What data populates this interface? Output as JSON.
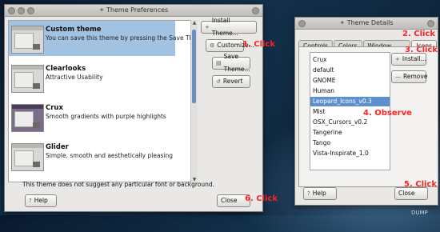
{
  "prefs_window": {
    "title": "Theme Preferences",
    "themes": [
      {
        "name": "Custom theme",
        "desc": "You can save this theme by pressing the Save Th...",
        "selected": true
      },
      {
        "name": "Clearlooks",
        "desc": "Attractive Usability",
        "selected": false
      },
      {
        "name": "Crux",
        "desc": "Smooth gradients with purple highlights",
        "selected": false
      },
      {
        "name": "Glider",
        "desc": "Simple, smooth and aesthetically pleasing",
        "selected": false
      }
    ],
    "buttons": {
      "install": "Install Theme...",
      "customize": "Customize...",
      "save": "Save Theme...",
      "revert": "Revert",
      "help": "Help",
      "close": "Close"
    },
    "note": "This theme does not suggest any particular font or background."
  },
  "details_window": {
    "title": "Theme Details",
    "tabs": [
      "Controls",
      "Colors",
      "Window Border",
      "Icons"
    ],
    "active_tab": "Icons",
    "icons": [
      "Crux",
      "default",
      "GNOME",
      "Human",
      "Leopard_Icons_v0.3",
      "Mist",
      "OSX_Cursors_v0.2",
      "Tangerine",
      "Tango",
      "Vista-Inspirate_1.0"
    ],
    "selected_icon": "Leopard_Icons_v0.3",
    "buttons": {
      "install": "Install...",
      "remove": "Remove",
      "help": "Help",
      "close": "Close"
    }
  },
  "annotations": {
    "a1": "1. Click",
    "a2": "2. Click",
    "a3": "3. Click",
    "a4": "4. Observe",
    "a5": "5. Click",
    "a6": "6. Click"
  },
  "desktop_label": "DUMP",
  "colors": {
    "annotation": "#ff2222",
    "selection": "#a2c2e2",
    "list_selection": "#5c8fd0"
  }
}
